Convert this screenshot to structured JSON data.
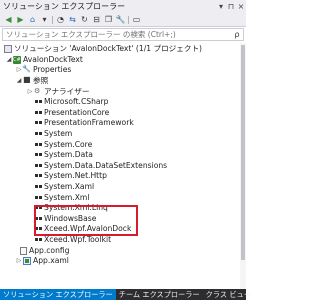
{
  "window": {
    "title": "ソリューション エクスプローラー",
    "pin": "⊓",
    "close": "×",
    "dropdown": "▾"
  },
  "toolbar": {
    "icons": [
      "home-icon",
      "back-icon",
      "forward-icon",
      "sync-icon"
    ]
  },
  "search": {
    "placeholder": "ソリューション エクスプローラー の検索 (Ctrl+;)",
    "icon": "ρ"
  },
  "tree": {
    "solution": "ソリューション 'AvalonDockText' (1/1 プロジェクト)",
    "project": "AvalonDockText",
    "properties": "Properties",
    "references": "参照",
    "analyzers": "アナライザー",
    "refs": [
      "Microsoft.CSharp",
      "PresentationCore",
      "PresentationFramework",
      "System",
      "System.Core",
      "System.Data",
      "System.Data.DataSetExtensions",
      "System.Net.Http",
      "System.Xaml",
      "System.Xml",
      "System.Xml.Linq",
      "WindowsBase",
      "Xceed.Wpf.AvalonDock",
      "Xceed.Wpf.Toolkit"
    ],
    "app_config": "App.config",
    "app_xaml": "App.xaml"
  },
  "tabs": [
    "ソリューション エクスプローラー",
    "チーム エクスプローラー",
    "クラス ビュー"
  ],
  "colors": {
    "highlight_border": "#d81b2c",
    "active_tab": "#007acc"
  }
}
